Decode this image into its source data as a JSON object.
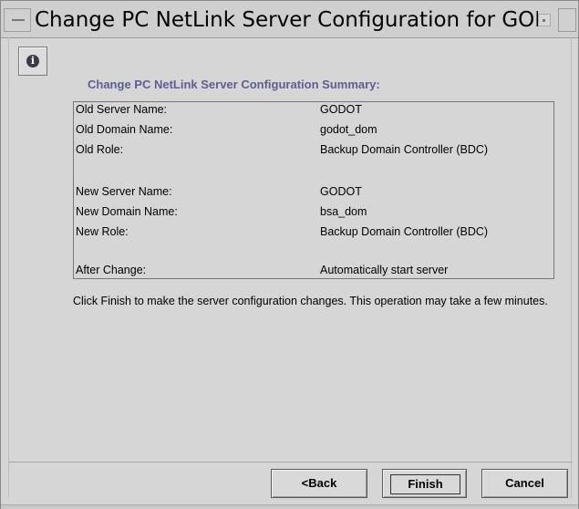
{
  "window": {
    "title": "Change PC NetLink Server Configuration for GODOT"
  },
  "dialog": {
    "heading": "Change PC NetLink Server Configuration Summary:",
    "rows": [
      {
        "label": "Old Server Name:",
        "value": "GODOT"
      },
      {
        "label": "Old Domain Name:",
        "value": "godot_dom"
      },
      {
        "label": "Old Role:",
        "value": "Backup Domain Controller (BDC)"
      },
      {
        "label": "New Server Name:",
        "value": "GODOT"
      },
      {
        "label": "New Domain Name:",
        "value": "bsa_dom"
      },
      {
        "label": "New Role:",
        "value": "Backup Domain Controller (BDC)"
      },
      {
        "label": "After Change:",
        "value": "Automatically start server"
      }
    ],
    "description": "Click Finish to make the server configuration changes. This operation may take a few minutes."
  },
  "buttons": {
    "back": "<Back",
    "finish": "Finish",
    "cancel": "Cancel"
  },
  "icons": {
    "info": "info-icon"
  }
}
